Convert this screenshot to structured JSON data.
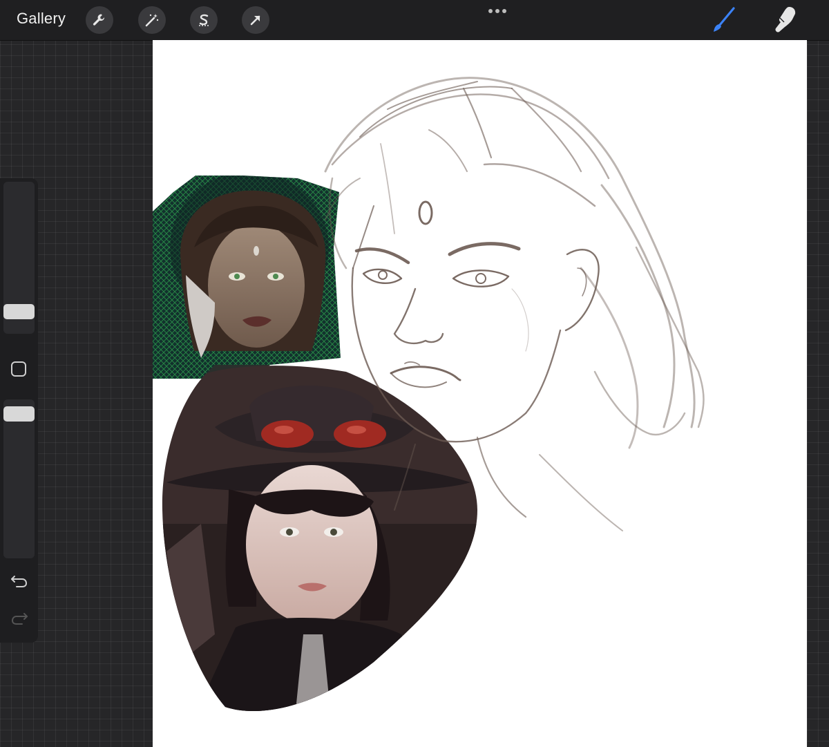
{
  "toolbar": {
    "gallery_label": "Gallery",
    "tools": [
      {
        "name": "actions",
        "icon": "wrench-icon"
      },
      {
        "name": "adjustments",
        "icon": "magic-wand-icon"
      },
      {
        "name": "selection",
        "icon": "selection-s-icon"
      },
      {
        "name": "transform",
        "icon": "arrow-cursor-icon"
      }
    ],
    "right_tools": [
      {
        "name": "brush",
        "icon": "brush-icon",
        "active": true
      },
      {
        "name": "smudge",
        "icon": "smudge-finger-icon",
        "active": false
      }
    ],
    "more_icon": "ellipsis-icon"
  },
  "sidebar": {
    "size_slider_level": 0.84,
    "opacity_slider_level": 0.98,
    "modify_icon": "square-modify-icon",
    "undo_icon": "undo-arrow-icon",
    "redo_icon": "redo-arrow-icon"
  },
  "colors": {
    "accent_active": "#3b82f6",
    "toolbar_bg": "#1f1f21",
    "canvas_bg": "#ffffff",
    "sketch_stroke": "#6b5a52"
  }
}
